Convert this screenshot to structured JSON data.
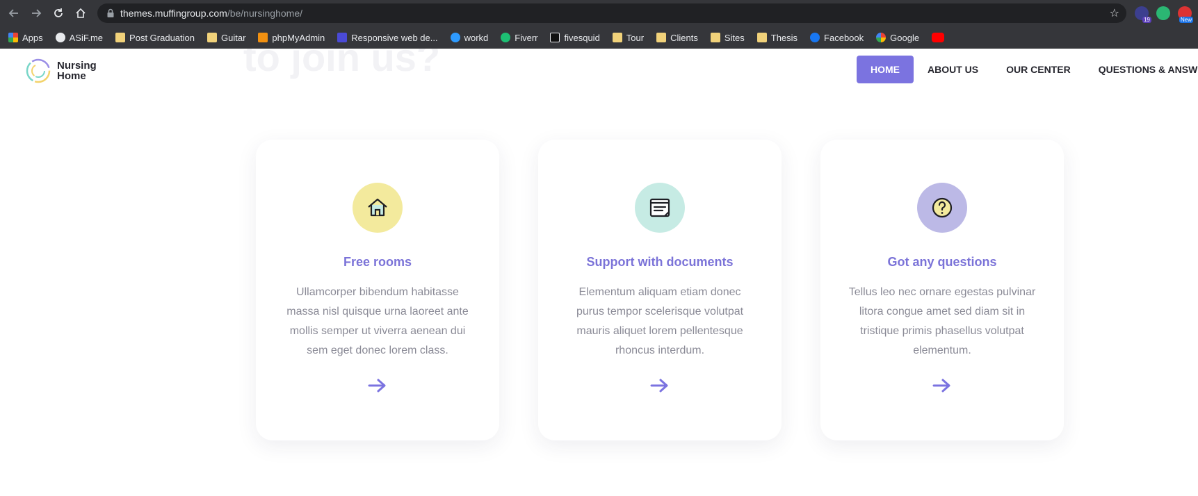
{
  "browser": {
    "url_host": "themes.muffingroup.com",
    "url_path": "/be/nursinghome/",
    "ext_badges": [
      "19",
      "New"
    ],
    "bookmarks": [
      {
        "label": "Apps",
        "icon": "apps-grid-icon"
      },
      {
        "label": "ASiF.me",
        "icon": "globe-icon"
      },
      {
        "label": "Post Graduation",
        "icon": "folder-icon"
      },
      {
        "label": "Guitar",
        "icon": "folder-icon"
      },
      {
        "label": "phpMyAdmin",
        "icon": "phpmyadmin-icon"
      },
      {
        "label": "Responsive web de...",
        "icon": "w-icon"
      },
      {
        "label": "workd",
        "icon": "workd-icon"
      },
      {
        "label": "Fiverr",
        "icon": "fiverr-icon"
      },
      {
        "label": "fivesquid",
        "icon": "f-icon"
      },
      {
        "label": "Tour",
        "icon": "folder-icon"
      },
      {
        "label": "Clients",
        "icon": "folder-icon"
      },
      {
        "label": "Sites",
        "icon": "folder-icon"
      },
      {
        "label": "Thesis",
        "icon": "folder-icon"
      },
      {
        "label": "Facebook",
        "icon": "facebook-icon"
      },
      {
        "label": "Google",
        "icon": "google-icon"
      },
      {
        "label": "",
        "icon": "youtube-icon"
      }
    ]
  },
  "site": {
    "ghost_heading": "to join us?",
    "logo": {
      "line1": "Nursing",
      "line2": "Home"
    },
    "nav": [
      {
        "label": "HOME",
        "active": true
      },
      {
        "label": "ABOUT US",
        "active": false
      },
      {
        "label": "OUR CENTER",
        "active": false
      },
      {
        "label": "QUESTIONS & ANSW",
        "active": false
      }
    ],
    "cards": [
      {
        "title": "Free rooms",
        "text": "Ullamcorper bibendum habitasse massa nisl quisque urna laoreet ante mollis semper ut viverra aenean dui sem eget donec lorem class.",
        "icon": "house-icon",
        "circle_color": "#f3ea9d"
      },
      {
        "title": "Support with documents",
        "text": "Elementum aliquam etiam donec purus tempor scelerisque volutpat mauris aliquet lorem pellentesque rhoncus interdum.",
        "icon": "document-icon",
        "circle_color": "#c6ebe4"
      },
      {
        "title": "Got any questions",
        "text": "Tellus leo nec ornare egestas pulvinar litora congue amet sed diam sit in tristique primis phasellus volutpat elementum.",
        "icon": "question-icon",
        "circle_color": "#bcb9e6"
      }
    ],
    "accent_color": "#7b73e0"
  }
}
